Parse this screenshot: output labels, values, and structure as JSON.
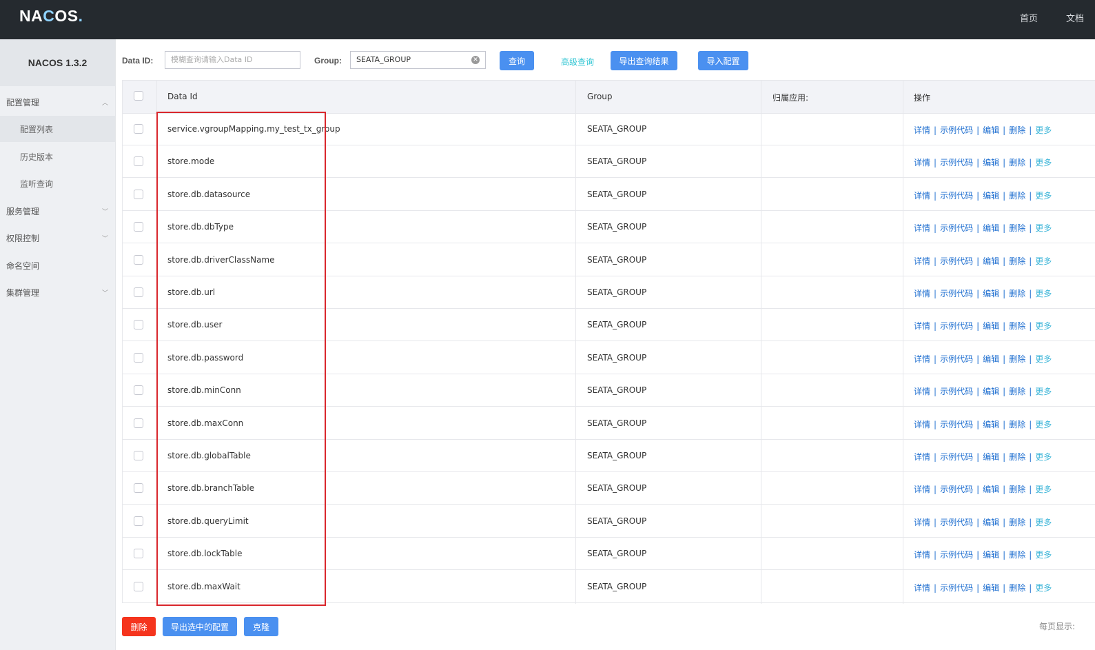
{
  "header": {
    "logo": "NACOS.",
    "nav": [
      "首页",
      "文档"
    ]
  },
  "sidebar": {
    "version": "NACOS 1.3.2",
    "items": [
      {
        "label": "配置管理",
        "expandable": true
      },
      {
        "label": "配置列表",
        "sub": true,
        "active": true
      },
      {
        "label": "历史版本",
        "sub": true
      },
      {
        "label": "监听查询",
        "sub": true
      },
      {
        "label": "服务管理",
        "expandable": true
      },
      {
        "label": "权限控制",
        "expandable": true
      },
      {
        "label": "命名空间"
      },
      {
        "label": "集群管理",
        "expandable": true
      }
    ]
  },
  "search": {
    "dataid_label": "Data ID:",
    "dataid_placeholder": "模糊查询请输入Data ID",
    "group_label": "Group:",
    "group_value": "SEATA_GROUP",
    "query_button": "查询",
    "advanced_link": "高级查询",
    "export_button": "导出查询结果",
    "import_button": "导入配置"
  },
  "table": {
    "columns": [
      "Data Id",
      "Group",
      "归属应用:",
      "操作"
    ],
    "ops": [
      "详情",
      "示例代码",
      "编辑",
      "删除",
      "更多"
    ],
    "rows": [
      {
        "dataId": "service.vgroupMapping.my_test_tx_group",
        "group": "SEATA_GROUP"
      },
      {
        "dataId": "store.mode",
        "group": "SEATA_GROUP"
      },
      {
        "dataId": "store.db.datasource",
        "group": "SEATA_GROUP"
      },
      {
        "dataId": "store.db.dbType",
        "group": "SEATA_GROUP"
      },
      {
        "dataId": "store.db.driverClassName",
        "group": "SEATA_GROUP"
      },
      {
        "dataId": "store.db.url",
        "group": "SEATA_GROUP"
      },
      {
        "dataId": "store.db.user",
        "group": "SEATA_GROUP"
      },
      {
        "dataId": "store.db.password",
        "group": "SEATA_GROUP"
      },
      {
        "dataId": "store.db.minConn",
        "group": "SEATA_GROUP"
      },
      {
        "dataId": "store.db.maxConn",
        "group": "SEATA_GROUP"
      },
      {
        "dataId": "store.db.globalTable",
        "group": "SEATA_GROUP"
      },
      {
        "dataId": "store.db.branchTable",
        "group": "SEATA_GROUP"
      },
      {
        "dataId": "store.db.queryLimit",
        "group": "SEATA_GROUP"
      },
      {
        "dataId": "store.db.lockTable",
        "group": "SEATA_GROUP"
      },
      {
        "dataId": "store.db.maxWait",
        "group": "SEATA_GROUP"
      }
    ]
  },
  "footer": {
    "delete_button": "删除",
    "export_selected_button": "导出选中的配置",
    "clone_button": "克隆",
    "page_size_label": "每页显示:"
  },
  "colors": {
    "topbar": "#252a2f",
    "primary": "#4a90f0",
    "danger": "#f5341d",
    "highlight_box": "#d9262c"
  }
}
